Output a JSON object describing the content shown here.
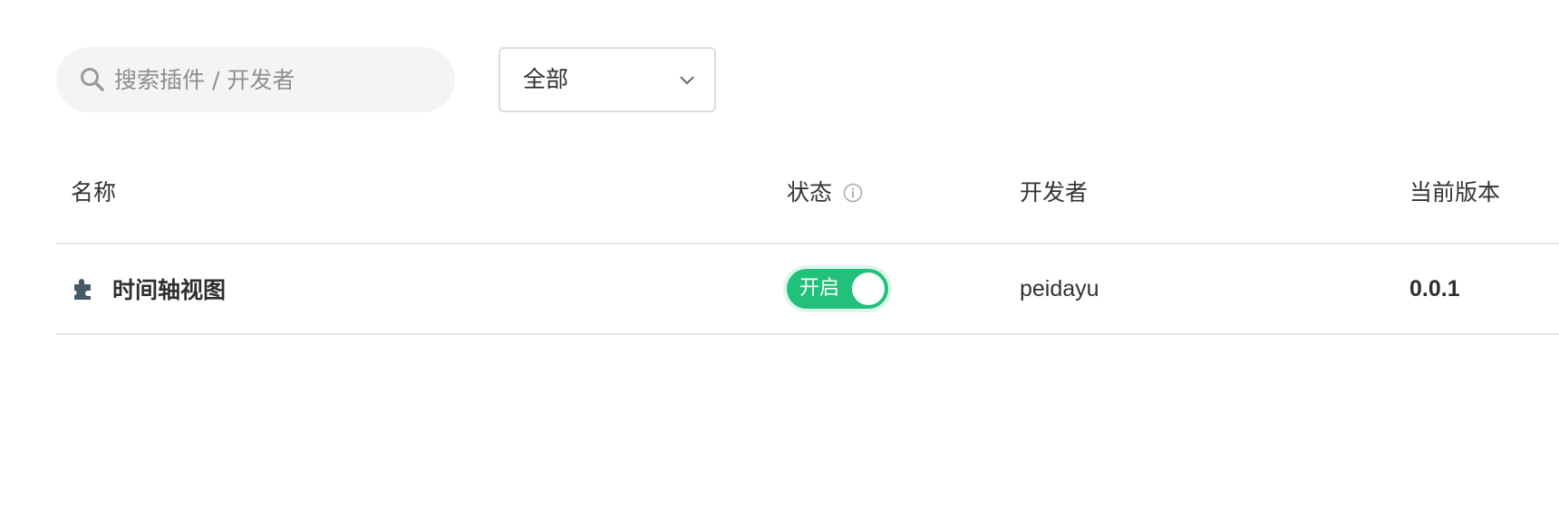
{
  "toolbar": {
    "search": {
      "placeholder": "搜索插件 / 开发者",
      "value": ""
    },
    "filter": {
      "selected": "全部"
    }
  },
  "table": {
    "columns": {
      "name": "名称",
      "status": "状态",
      "developer": "开发者",
      "version": "当前版本"
    },
    "rows": [
      {
        "icon": "puzzle-piece-icon",
        "name": "时间轴视图",
        "status_label": "开启",
        "enabled": true,
        "developer": "peidayu",
        "version": "0.0.1"
      }
    ]
  },
  "colors": {
    "accent_green": "#22c17b",
    "search_bg": "#f4f4f4",
    "divider": "#e5e5e5",
    "icon_slate": "#455a64"
  }
}
